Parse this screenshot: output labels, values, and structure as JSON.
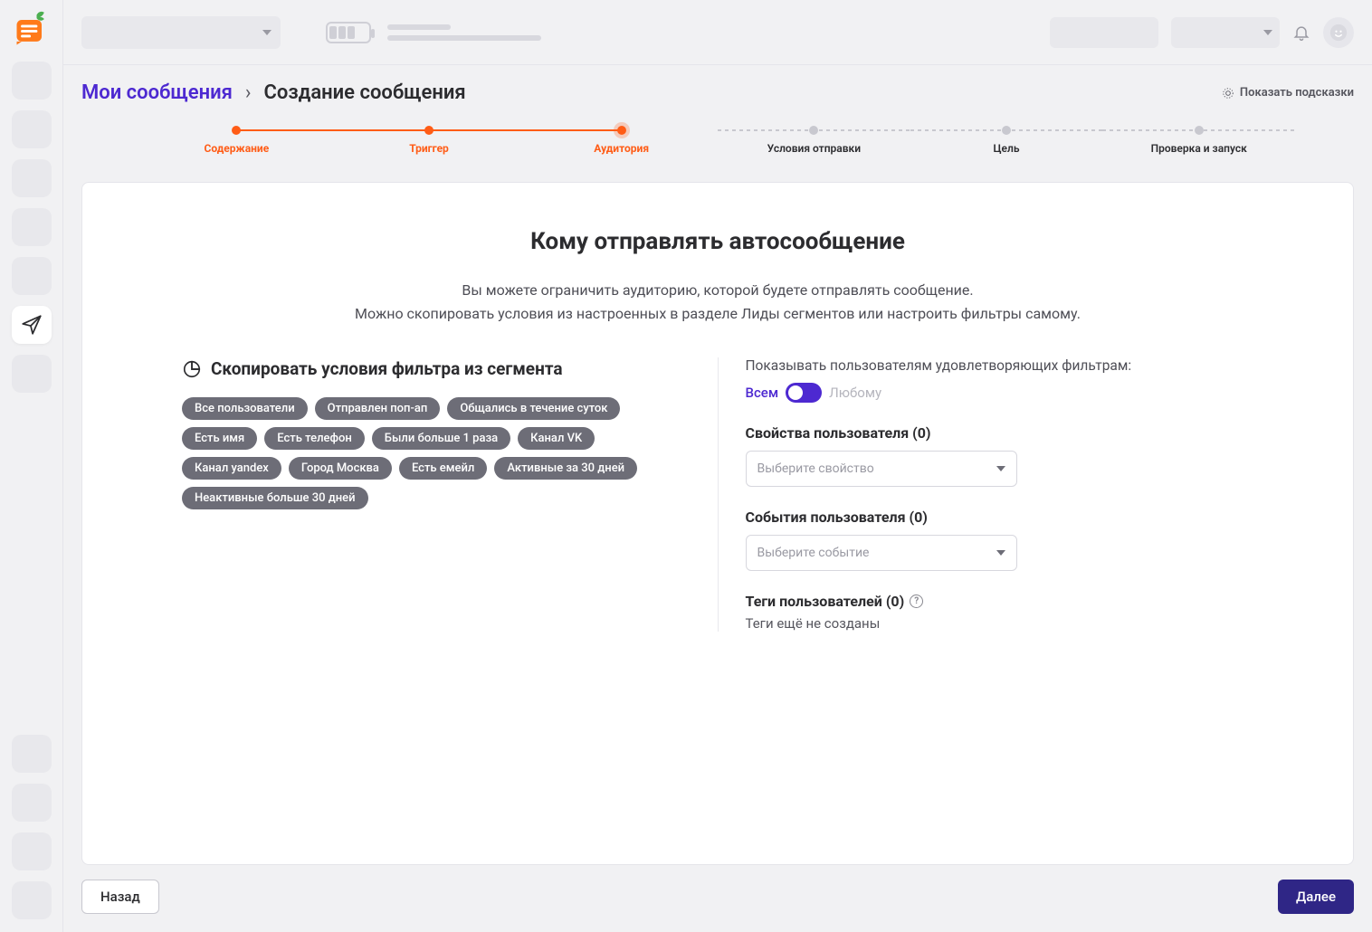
{
  "breadcrumb": {
    "root": "Мои сообщения",
    "current": "Создание сообщения"
  },
  "hints_label": "Показать подсказки",
  "steps": [
    {
      "label": "Содержание",
      "state": "done"
    },
    {
      "label": "Триггер",
      "state": "done"
    },
    {
      "label": "Аудитория",
      "state": "current"
    },
    {
      "label": "Условия отправки",
      "state": "todo"
    },
    {
      "label": "Цель",
      "state": "todo"
    },
    {
      "label": "Проверка и запуск",
      "state": "todo"
    }
  ],
  "card": {
    "title": "Кому отправлять автосообщение",
    "desc_line1": "Вы можете ограничить аудиторию, которой будете отправлять сообщение.",
    "desc_line2": "Можно скопировать условия из настроенных в разделе Лиды сегментов или настроить фильтры самому."
  },
  "segment": {
    "title": "Скопировать условия фильтра из сегмента",
    "pills": [
      "Все пользователи",
      "Отправлен поп-ап",
      "Общались в течение суток",
      "Есть имя",
      "Есть телефон",
      "Были больше 1 раза",
      "Канал VK",
      "Канал yandex",
      "Город Москва",
      "Есть емейл",
      "Активные за 30 дней",
      "Неактивные больше 30 дней"
    ]
  },
  "filters": {
    "caption": "Показывать пользователям удовлетворяющих фильтрам:",
    "toggle_all": "Всем",
    "toggle_any": "Любому",
    "properties_title": "Свойства пользователя (0)",
    "properties_placeholder": "Выберите свойство",
    "events_title": "События пользователя (0)",
    "events_placeholder": "Выберите событие",
    "tags_title": "Теги пользователей (0)",
    "tags_empty": "Теги ещё не созданы"
  },
  "footer": {
    "back": "Назад",
    "next": "Далее"
  }
}
